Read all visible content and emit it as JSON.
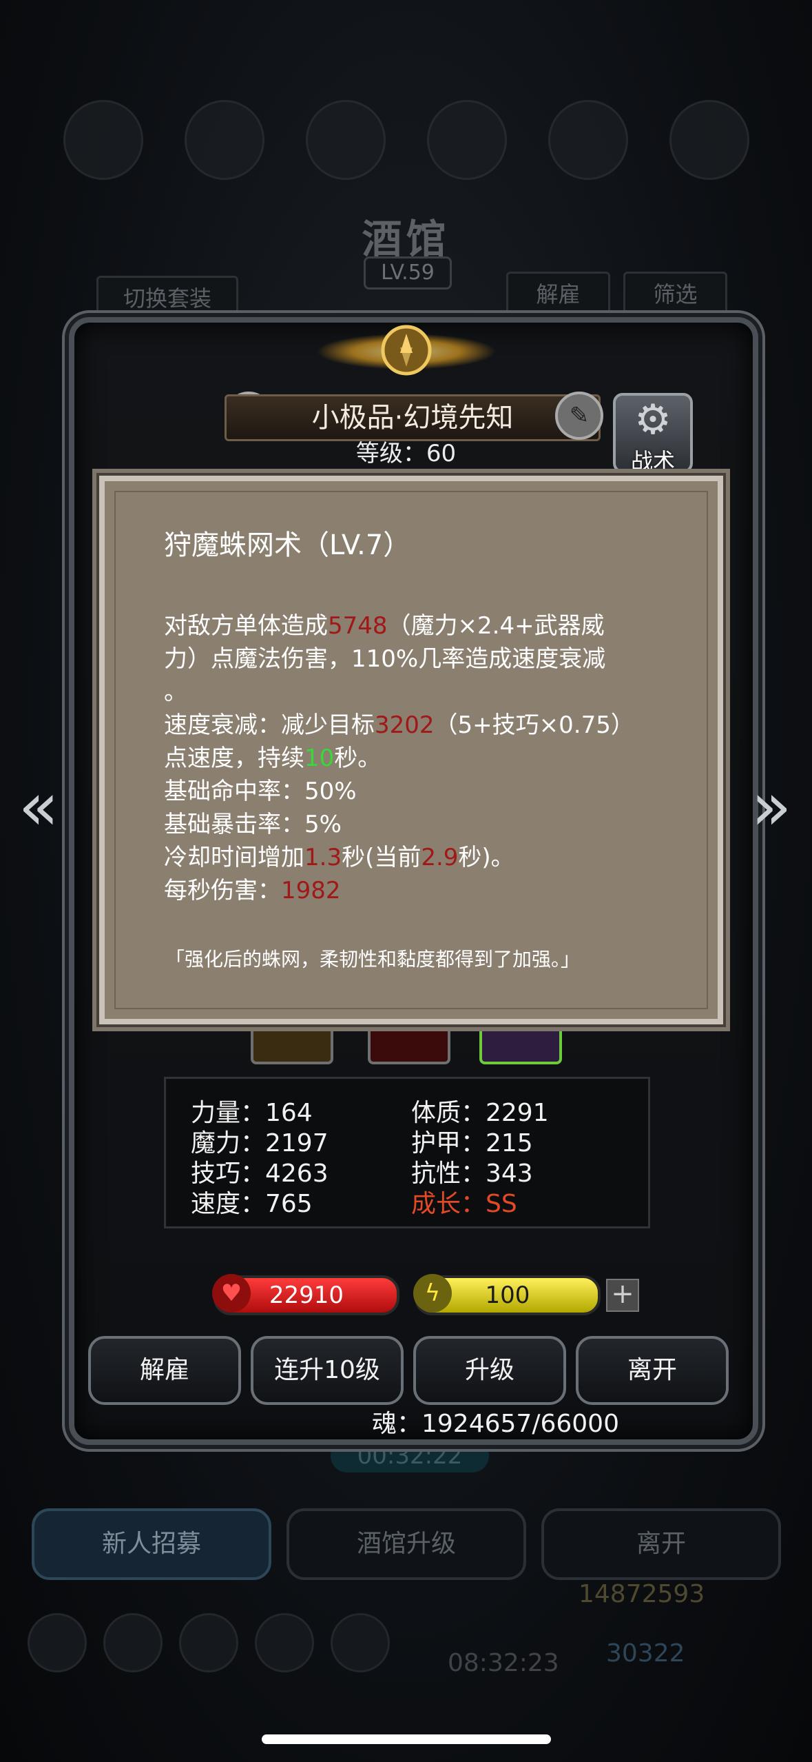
{
  "background": {
    "title": "酒馆",
    "level": "LV.59",
    "switch_outfit": "切换套装",
    "dismiss": "解雇",
    "filter": "筛选",
    "timer": "00:32:22",
    "tabs": [
      "新人招募",
      "酒馆升级",
      "离开"
    ],
    "gold": "14872593",
    "gems": "30322",
    "clock": "08:32:23"
  },
  "hero": {
    "name": "小极品·幻境先知",
    "level_line": "等级：60",
    "tactic_label": "战术"
  },
  "skill": {
    "title": "狩魔蛛网术（LV.7）",
    "l1_a": "对敌方单体造成",
    "l1_dmg": "5748",
    "l1_b": "（魔力×2.4+武器威",
    "l2": "力）点魔法伤害，110%几率造成速度衰减",
    "l3": "。",
    "l4_a": "速度衰减：减少目标",
    "l4_val": "3202",
    "l4_b": "（5+技巧×0.75）",
    "l5_a": "点速度，持续",
    "l5_sec": "10",
    "l5_b": "秒。",
    "hit_rate": "基础命中率：50%",
    "crit_rate": "基础暴击率：5%",
    "cd_a": "冷却时间增加",
    "cd_inc": "1.3",
    "cd_b": "秒(当前",
    "cd_cur": "2.9",
    "cd_c": "秒)。",
    "dps_a": "每秒伤害：",
    "dps_val": "1982",
    "flavor": "「强化后的蛛网，柔韧性和黏度都得到了加强。」"
  },
  "stats": {
    "strength": "力量：164",
    "constitution": "体质：2291",
    "magic": "魔力：2197",
    "armor": "护甲：215",
    "skill": "技巧：4263",
    "resist": "抗性：343",
    "speed": "速度：765",
    "growth": "成长：SS"
  },
  "bars": {
    "hp": "22910",
    "energy": "100",
    "plus": "+"
  },
  "actions": [
    "解雇",
    "连升10级",
    "升级",
    "离开"
  ],
  "soul": "魂：1924657/66000",
  "icons": {
    "nav_left": "double-chevron-left-icon",
    "nav_right": "double-chevron-right-icon",
    "hp": "heart-icon",
    "energy": "lightning-icon",
    "tactic": "gear-icon",
    "badge": "medal-icon",
    "edit": "edit-icon"
  },
  "colors": {
    "damage_value": "#a01818",
    "duration_value": "#38d838",
    "growth": "#e24a26",
    "hp_bar": "#e01c1c",
    "energy_bar": "#e8dc1e"
  }
}
